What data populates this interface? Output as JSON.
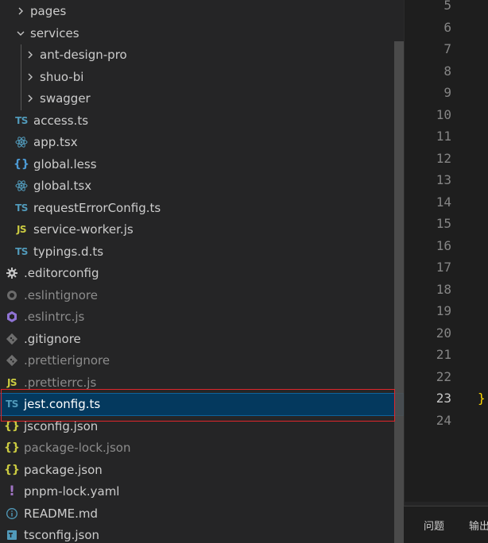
{
  "explorer": {
    "items": [
      {
        "label": "pages",
        "kind": "folder",
        "expanded": false,
        "depth": 1,
        "dim": false
      },
      {
        "label": "services",
        "kind": "folder",
        "expanded": true,
        "depth": 1,
        "dim": false
      },
      {
        "label": "ant-design-pro",
        "kind": "folder",
        "expanded": false,
        "depth": 2,
        "dim": false
      },
      {
        "label": "shuo-bi",
        "kind": "folder",
        "expanded": false,
        "depth": 2,
        "dim": false
      },
      {
        "label": "swagger",
        "kind": "folder",
        "expanded": false,
        "depth": 2,
        "dim": false
      },
      {
        "label": "access.ts",
        "kind": "ts",
        "depth": 1,
        "dim": false
      },
      {
        "label": "app.tsx",
        "kind": "react",
        "depth": 1,
        "dim": false
      },
      {
        "label": "global.less",
        "kind": "less",
        "depth": 1,
        "dim": false
      },
      {
        "label": "global.tsx",
        "kind": "react",
        "depth": 1,
        "dim": false
      },
      {
        "label": "requestErrorConfig.ts",
        "kind": "ts",
        "depth": 1,
        "dim": false
      },
      {
        "label": "service-worker.js",
        "kind": "js",
        "depth": 1,
        "dim": false
      },
      {
        "label": "typings.d.ts",
        "kind": "ts",
        "depth": 1,
        "dim": false
      },
      {
        "label": ".editorconfig",
        "kind": "gear",
        "depth": 0,
        "dim": false
      },
      {
        "label": ".eslintignore",
        "kind": "eslint-ignore",
        "depth": 0,
        "dim": true
      },
      {
        "label": ".eslintrc.js",
        "kind": "eslint",
        "depth": 0,
        "dim": true
      },
      {
        "label": ".gitignore",
        "kind": "git",
        "depth": 0,
        "dim": false
      },
      {
        "label": ".prettierignore",
        "kind": "git",
        "depth": 0,
        "dim": true
      },
      {
        "label": ".prettierrc.js",
        "kind": "js",
        "depth": 0,
        "dim": true
      },
      {
        "label": "jest.config.ts",
        "kind": "ts",
        "depth": 0,
        "dim": false,
        "selected": true
      },
      {
        "label": "jsconfig.json",
        "kind": "json",
        "depth": 0,
        "dim": false
      },
      {
        "label": "package-lock.json",
        "kind": "json",
        "depth": 0,
        "dim": true
      },
      {
        "label": "package.json",
        "kind": "json",
        "depth": 0,
        "dim": false
      },
      {
        "label": "pnpm-lock.yaml",
        "kind": "yaml",
        "depth": 0,
        "dim": false
      },
      {
        "label": "README.md",
        "kind": "info",
        "depth": 0,
        "dim": false
      },
      {
        "label": "tsconfig.json",
        "kind": "tsconfig",
        "depth": 0,
        "dim": false
      }
    ]
  },
  "icons": {
    "ts": "TS",
    "js": "JS",
    "json": "{}",
    "less": "{}",
    "yaml": "!"
  },
  "editor": {
    "line_numbers": [
      "5",
      "6",
      "7",
      "8",
      "9",
      "10",
      "11",
      "12",
      "13",
      "14",
      "15",
      "16",
      "17",
      "18",
      "19",
      "20",
      "21",
      "22",
      "23",
      "24"
    ],
    "active_line": "23",
    "brace_text": "}",
    "brace_line": "23"
  },
  "panel": {
    "tabs": [
      "问题",
      "输出"
    ]
  },
  "colors": {
    "selection_bg": "#04395e",
    "highlight_border": "#e0262b",
    "ts_icon": "#519aba",
    "js_icon": "#cbcb41"
  }
}
